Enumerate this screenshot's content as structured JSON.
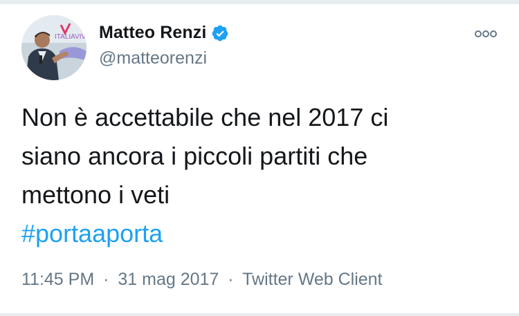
{
  "author": {
    "display_name": "Matteo Renzi",
    "handle": "@matteorenzi",
    "verified": true,
    "avatar_caption": "ITALIAVIVA"
  },
  "tweet": {
    "text": "Non è accettabile che nel 2017 ci\nsiano ancora i piccoli partiti che\nmettono i veti",
    "hashtag": "#portaaporta"
  },
  "meta": {
    "time": "11:45 PM",
    "separator": "·",
    "date": "31 mag 2017",
    "client": "Twitter Web Client"
  },
  "icons": {
    "verified": "verified-badge-icon",
    "more": "more-options-icon"
  },
  "colors": {
    "link": "#1da1f2",
    "verified": "#1da1f2",
    "text": "#14171a",
    "secondary": "#657786"
  }
}
